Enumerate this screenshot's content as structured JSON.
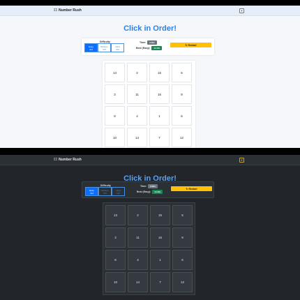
{
  "app": {
    "brand": "Number Rush",
    "brand_icon": "grid-icon",
    "theme_icon_light": "☀",
    "theme_icon_dark": "☀"
  },
  "game": {
    "title": "Click in Order!",
    "difficulty_label": "Difficulty",
    "difficulties": [
      {
        "name": "Easy",
        "size": "4x4",
        "sub": "16"
      },
      {
        "name": "Medium",
        "size": "5x5",
        "sub": "25"
      },
      {
        "name": "Hard",
        "size": "6x6",
        "sub": "36"
      }
    ],
    "time_label": "Time:",
    "time_value": "0.00s",
    "best_label": "Best (Easy):",
    "best_value": "14.46s",
    "restart_label": "Restart",
    "tiles": [
      13,
      2,
      15,
      5,
      3,
      11,
      16,
      9,
      8,
      4,
      1,
      6,
      10,
      14,
      7,
      12
    ]
  },
  "colors": {
    "accent": "#0d6efd",
    "title": "#2f7fe0",
    "restart": "#ffc107",
    "best_pill": "#198754",
    "time_pill": "#6c757d"
  }
}
